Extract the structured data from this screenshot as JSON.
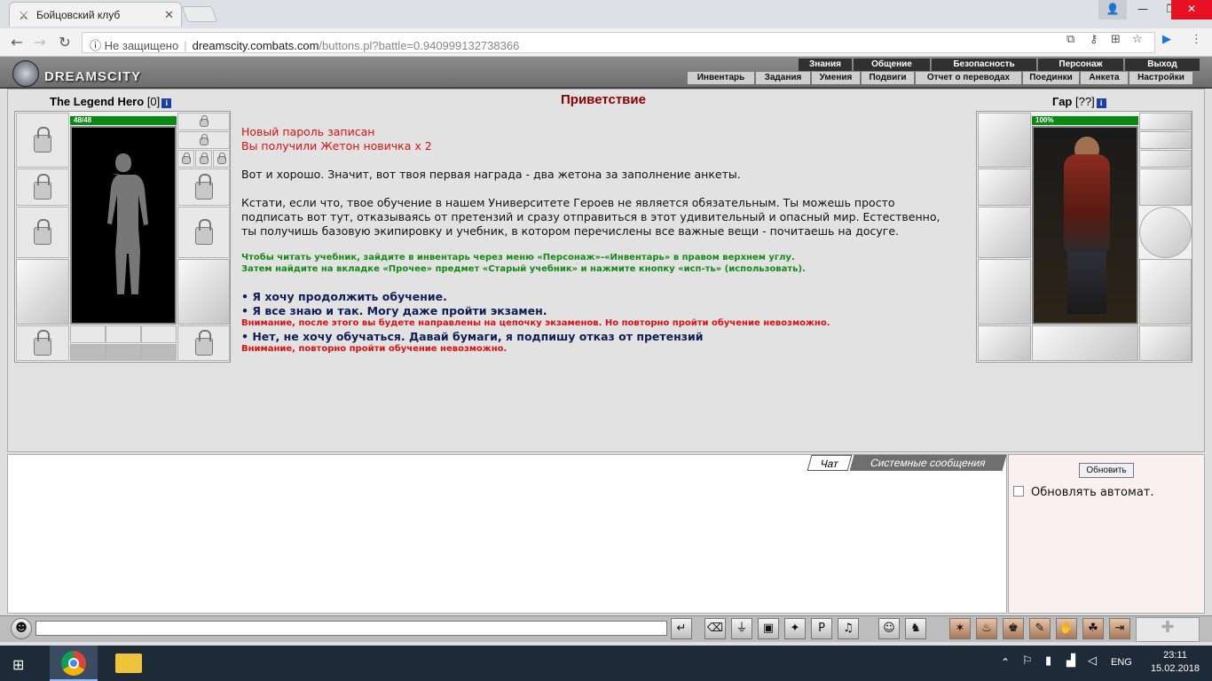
{
  "browser": {
    "tab_title": "Бойцовский клуб",
    "security_label": "Не защищено",
    "url_host": "dreamscity.combats.com",
    "url_path": "/buttons.pl?battle=0.940999132738366"
  },
  "site": {
    "logo": "DREAMSCITY",
    "top_menu": [
      "Знания",
      "Общение",
      "Безопасность",
      "Персонаж",
      "Выход"
    ],
    "sub_menu": [
      "Инвентарь",
      "Задания",
      "Умения",
      "Подвиги",
      "Отчет о переводах",
      "Поединки",
      "Анкета",
      "Настройки"
    ]
  },
  "player": {
    "name": "The Legend Hero",
    "level": "[0]",
    "hp": "48/48"
  },
  "npc": {
    "name": "Гар",
    "level": "[??]",
    "hp": "100%"
  },
  "content": {
    "title": "Приветствие",
    "notice1": "Новый пароль записан",
    "notice2": "Вы получили Жетон новичка x 2",
    "para1": "Вот и хорошо. Значит, вот твоя первая награда - два жетона за заполнение анкеты.",
    "para2_l1": "Кстати, если что, твое обучение в нашем Университете Героев не является обязательным. Ты можешь просто",
    "para2_l2": "подписать вот тут, отказываясь от претензий и сразу отправиться в этот удивительный и опасный мир. Естественно,",
    "para2_l3": "ты получишь базовую экипировку и учебник, в котором перечислены все важные вещи - почитаешь на досуге.",
    "hint1": "Чтобы читать учебник, зайдите в инвентарь через меню «Персонаж»-«Инвентарь» в правом верхнем углу.",
    "hint2": "Затем найдите на вкладке «Прочее» предмет «Старый учебник» и нажмите кнопку «исп-ть» (использовать).",
    "option1": "• Я хочу продолжить обучение.",
    "option2": "• Я все знаю и так. Могу даже пройти экзамен.",
    "warn2": "Внимание, после этого вы будете направлены на цепочку экзаменов. Но повторно пройти обучение невозможно.",
    "option3": "• Нет, не хочу обучаться. Давай бумаги, я подпишу отказ от претензий",
    "warn3": "Внимание, повторно пройти обучение невозможно."
  },
  "chat": {
    "tab_chat": "Чат",
    "tab_system": "Системные сообщения",
    "refresh_button": "Обновить",
    "auto_refresh_label": "Обновлять автомат."
  },
  "taskbar": {
    "lang": "ENG",
    "time": "23:11",
    "date": "15.02.2018"
  },
  "colors": {
    "title": "#8b0000",
    "notice": "#dd1111",
    "hint": "#158a15",
    "option": "#101e55",
    "hp_bar": "#0a8a12"
  }
}
